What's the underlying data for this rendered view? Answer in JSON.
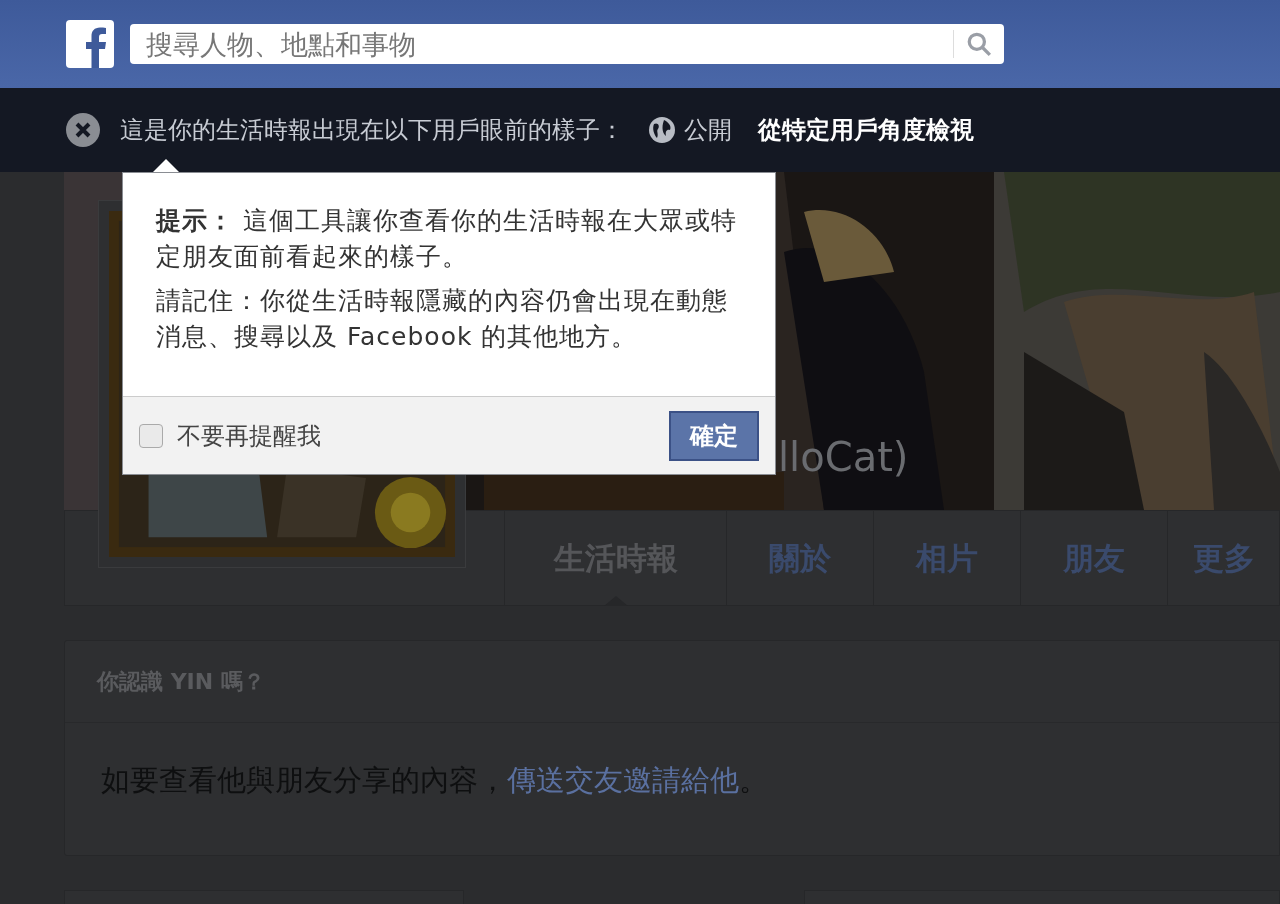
{
  "header": {
    "search": {
      "placeholder": "搜尋人物、地點和事物"
    }
  },
  "view_bar": {
    "message": "這是你的生活時報出現在以下用戶眼前的樣子：",
    "audience": "公開",
    "view_as_link": "從特定用戶角度檢視"
  },
  "cover": {
    "name": "lloCat)"
  },
  "tabs": [
    {
      "label": "生活時報",
      "selected": true
    },
    {
      "label": "關於",
      "selected": false
    },
    {
      "label": "相片",
      "selected": false
    },
    {
      "label": "朋友",
      "selected": false
    },
    {
      "label": "更多",
      "selected": false
    }
  ],
  "card": {
    "title": "你認識 YIN 嗎？",
    "body": "如要查看他與朋友分享的內容，",
    "link": "傳送交友邀請給他",
    "end": "。"
  },
  "popup": {
    "paragraphs": [
      "**提示：** 這個工具讓你查看你的生活時報在大眾或特定朋友面前看起來的樣子。",
      "請記住：你從生活時報隱藏的內容仍會出現在動態消息、搜尋以及 Facebook 的其他地方。"
    ],
    "checkbox": {
      "label": "不要再提醒我",
      "checked": false
    },
    "button": "確定"
  }
}
